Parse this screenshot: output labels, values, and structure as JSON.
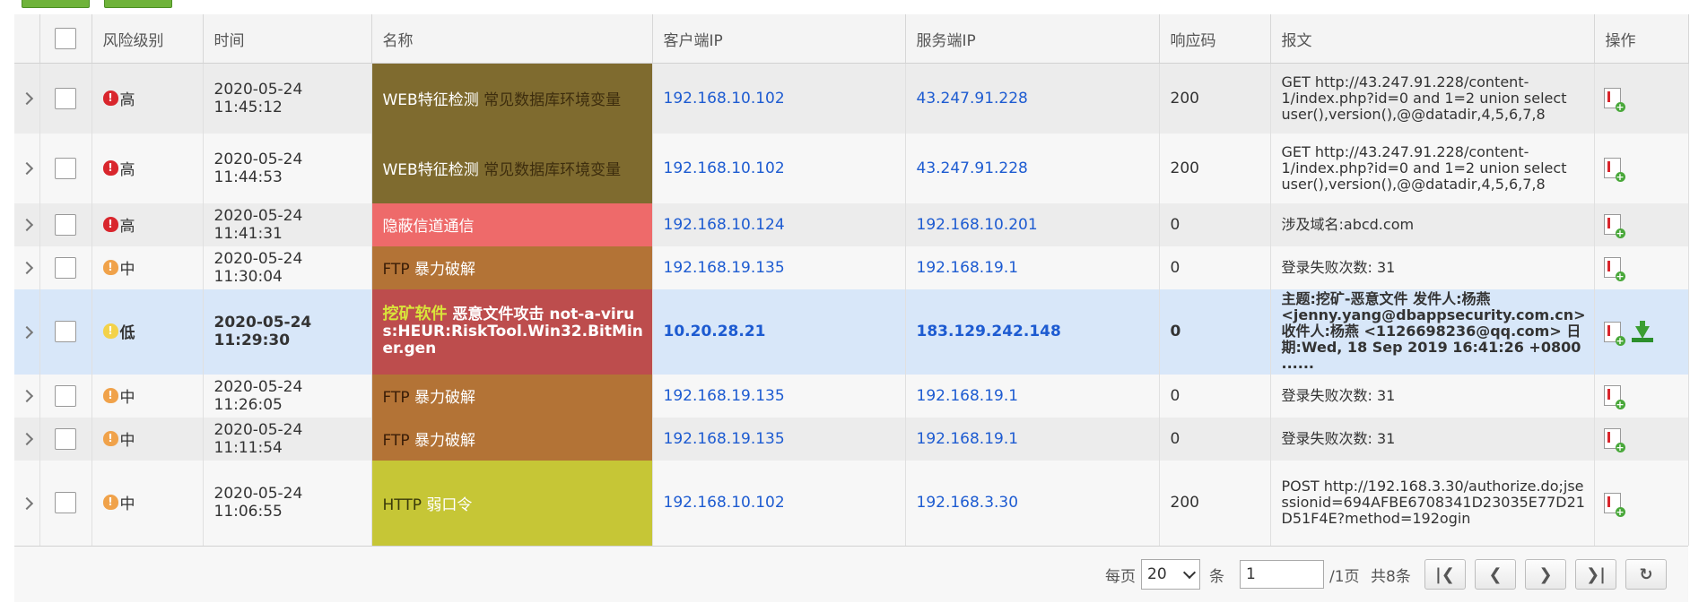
{
  "columns": {
    "risk": "风险级别",
    "time": "时间",
    "name": "名称",
    "client_ip": "客户端IP",
    "server_ip": "服务端IP",
    "response_code": "响应码",
    "message": "报文",
    "ops": "操作"
  },
  "rows": [
    {
      "risk": "高",
      "time": "2020-05-24 11:45:12",
      "name_a": "WEB特征检测",
      "name_b": "常见数据库环境变量",
      "name_c": "",
      "client": "192.168.10.102",
      "server": "43.247.91.228",
      "code": "200",
      "msg": "GET http://43.247.91.228/content-1/index.php?id=0 and 1=2 union select user(),version(),@@datadir,4,5,6,7,8"
    },
    {
      "risk": "高",
      "time": "2020-05-24 11:44:53",
      "name_a": "WEB特征检测",
      "name_b": "常见数据库环境变量",
      "name_c": "",
      "client": "192.168.10.102",
      "server": "43.247.91.228",
      "code": "200",
      "msg": "GET http://43.247.91.228/content-1/index.php?id=0 and 1=2 union select user(),version(),@@datadir,4,5,6,7,8"
    },
    {
      "risk": "高",
      "time": "2020-05-24 11:41:31",
      "name_a": "隐蔽信道通信",
      "name_b": "",
      "name_c": "",
      "client": "192.168.10.124",
      "server": "192.168.10.201",
      "code": "0",
      "msg": "涉及域名:abcd.com"
    },
    {
      "risk": "中",
      "time": "2020-05-24 11:30:04",
      "name_a": "FTP",
      "name_b": "暴力破解",
      "name_c": "",
      "client": "192.168.19.135",
      "server": "192.168.19.1",
      "code": "0",
      "msg": "登录失败次数: 31"
    },
    {
      "risk": "低",
      "time": "2020-05-24 11:29:30",
      "name_a": "挖矿软件",
      "name_b": "恶意文件攻击",
      "name_c": "not-a-virus:HEUR:RiskTool.Win32.BitMiner.gen",
      "client": "10.20.28.21",
      "server": "183.129.242.148",
      "code": "0",
      "msg": "主题:挖矿-恶意文件 发件人:杨燕 <jenny.yang@dbappsecurity.com.cn> 收件人:杨燕 <1126698236@qq.com> 日期:Wed, 18 Sep 2019 16:41:26 +0800 ......"
    },
    {
      "risk": "中",
      "time": "2020-05-24 11:26:05",
      "name_a": "FTP",
      "name_b": "暴力破解",
      "name_c": "",
      "client": "192.168.19.135",
      "server": "192.168.19.1",
      "code": "0",
      "msg": "登录失败次数: 31"
    },
    {
      "risk": "中",
      "time": "2020-05-24 11:11:54",
      "name_a": "FTP",
      "name_b": "暴力破解",
      "name_c": "",
      "client": "192.168.19.135",
      "server": "192.168.19.1",
      "code": "0",
      "msg": "登录失败次数: 31"
    },
    {
      "risk": "中",
      "time": "2020-05-24 11:06:55",
      "name_a": "HTTP",
      "name_b": "弱口令",
      "name_c": "",
      "client": "192.168.10.102",
      "server": "192.168.3.30",
      "code": "200",
      "msg": "POST http://192.168.3.30/authorize.do;jsessionid=694AFBE6708341D23035E77D21D51F4E?method=192ogin"
    }
  ],
  "pager": {
    "per_page_label": "每页",
    "per_page_value": "20",
    "unit": "条",
    "page_input": "1",
    "total_pages": "/1页",
    "total_count": "共8条"
  },
  "colors": {
    "high": "#d9262d",
    "medium": "#f0a24a",
    "low": "#f3d24a",
    "web_feature": "#7f6b2f",
    "covert_channel": "#ee6a6a",
    "ftp_bruteforce": "#b37336",
    "mining": "#bd4d4d",
    "http_weak": "#c6c636",
    "link_blue": "#1d5bd1",
    "selected_row": "#d8e7f9"
  }
}
